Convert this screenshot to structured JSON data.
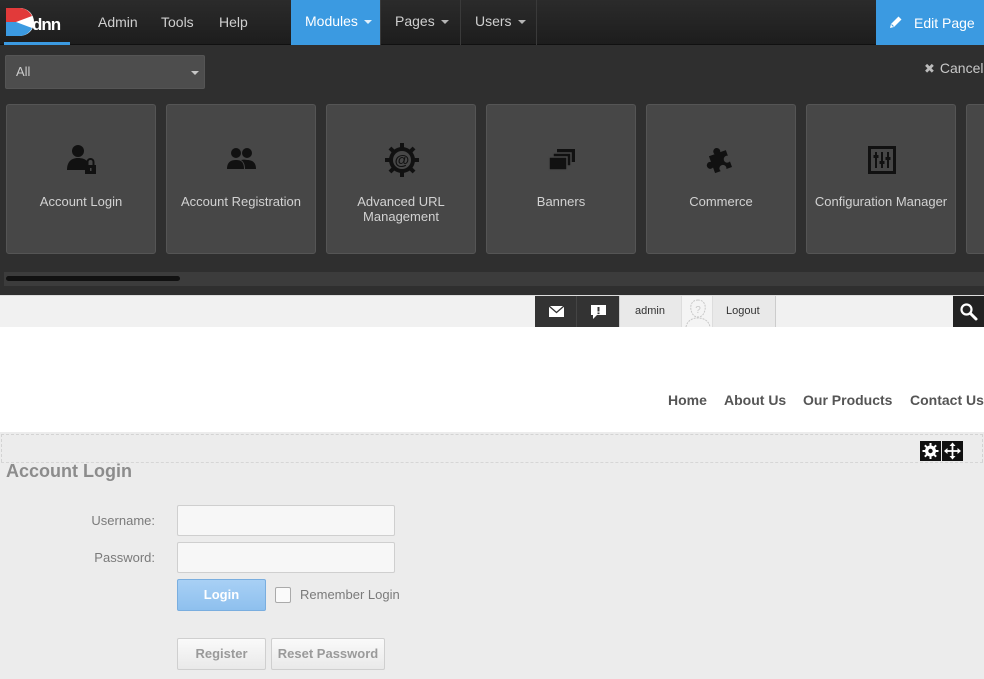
{
  "topbar": {
    "logo_text": "DNN",
    "links": [
      "Admin",
      "Tools",
      "Help"
    ],
    "tabs": [
      "Modules",
      "Pages",
      "Users"
    ],
    "active_tab": "Modules",
    "edit_page_label": "Edit Page"
  },
  "module_panel": {
    "filter_value": "All",
    "cancel_label": "Cancel",
    "modules": [
      {
        "title": "Account Login",
        "icon": "user-lock-icon"
      },
      {
        "title": "Account Registration",
        "icon": "users-icon"
      },
      {
        "title": "Advanced URL Management",
        "icon": "at-gear-icon"
      },
      {
        "title": "Banners",
        "icon": "stacked-banners-icon"
      },
      {
        "title": "Commerce",
        "icon": "puzzle-icon"
      },
      {
        "title": "Configuration Manager",
        "icon": "sliders-icon"
      }
    ]
  },
  "userbar": {
    "username": "admin",
    "logout_label": "Logout"
  },
  "site_nav": [
    "Home",
    "About Us",
    "Our Products",
    "Contact Us"
  ],
  "login_module": {
    "title": "Account Login",
    "username_label": "Username:",
    "password_label": "Password:",
    "login_button": "Login",
    "remember_label": "Remember Login",
    "register_button": "Register",
    "reset_button": "Reset Password"
  },
  "colors": {
    "accent": "#3b9ae1",
    "toolbar_bg": "#2b2b2b",
    "panel_bg": "#2f2f2f",
    "card_bg": "#474747"
  }
}
